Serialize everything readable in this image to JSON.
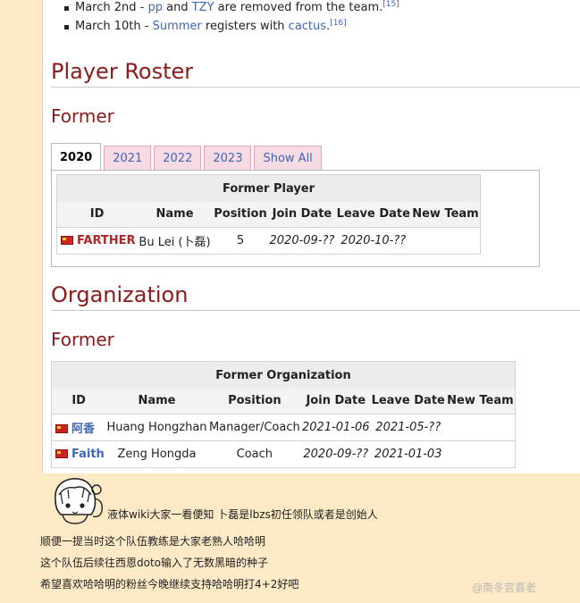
{
  "news": [
    {
      "date_prefix": "March 2nd - ",
      "a": "pp",
      "mid": " and ",
      "b": "TZY",
      "suffix": " are removed from the team.",
      "ref": "[15]"
    },
    {
      "date_prefix": "March 10th - ",
      "a": "Summer",
      "mid": " registers with ",
      "b": "cactus",
      "suffix": ".",
      "ref": "[16]"
    }
  ],
  "player_roster": {
    "heading": "Player Roster",
    "subheading": "Former",
    "tabs": [
      "2020",
      "2021",
      "2022",
      "2023",
      "Show All"
    ],
    "active_tab": "2020",
    "table_caption": "Former Player",
    "columns": [
      "ID",
      "Name",
      "Position",
      "Join Date",
      "Leave Date",
      "New Team"
    ],
    "rows": [
      {
        "id": "FARTHER",
        "name": "Bu Lei (卜磊)",
        "position": "5",
        "join": "2020-09-??",
        "leave": "2020-10-??",
        "new_team": ""
      }
    ]
  },
  "organization": {
    "heading": "Organization",
    "subheading": "Former",
    "table_caption": "Former Organization",
    "columns": [
      "ID",
      "Name",
      "Position",
      "Join Date",
      "Leave Date",
      "New Team"
    ],
    "rows": [
      {
        "id": "阿香",
        "name": "Huang Hongzhan",
        "position": "Manager/Coach",
        "join": "2021-01-06",
        "leave": "2021-05-??",
        "new_team": ""
      },
      {
        "id": "Faith",
        "name": "Zeng Hongda",
        "position": "Coach",
        "join": "2020-09-??",
        "leave": "2021-01-03",
        "new_team": ""
      }
    ]
  },
  "comments": [
    "液体wiki大家一看便知  卜磊是lbzs初任领队或者是创始人",
    "顺便一提当时这个队伍教练是大家老熟人哈哈明",
    "这个队伍后续往西恩doto输入了无数黑暗的种子",
    "希望喜欢哈哈明的粉丝今晚继续支持哈哈明打4+2好吧"
  ],
  "watermark": "@南冬宫喜老",
  "colors": {
    "heading": "#8b1a1a",
    "link": "#3f66b8",
    "redlink": "#b32424",
    "background": "#fce9c6"
  }
}
